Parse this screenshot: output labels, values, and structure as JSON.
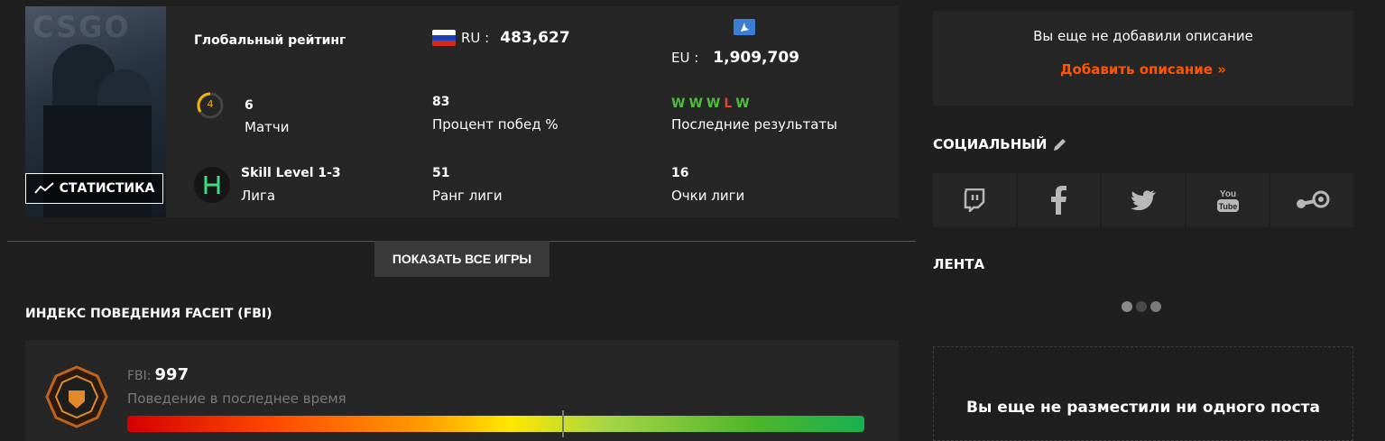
{
  "game_card": {
    "cover_logo": "CSGO",
    "stats_button": "СТАТИСТИКА",
    "global_rating_label": "Глобальный рейтинг",
    "ru_label": "RU :",
    "ru_value": "483,627",
    "eu_label": "EU :",
    "eu_value": "1,909,709",
    "level_badge": "4",
    "matches_value": "6",
    "matches_label": "Матчи",
    "win_rate_value": "83",
    "win_rate_label": "Процент побед %",
    "recent_results": [
      "W",
      "W",
      "W",
      "L",
      "W"
    ],
    "recent_results_label": "Последние результаты",
    "league_value": "Skill Level 1-3",
    "league_label": "Лига",
    "league_rank_value": "51",
    "league_rank_label": "Ранг лиги",
    "league_points_value": "16",
    "league_points_label": "Очки лиги"
  },
  "show_all_games": "ПОКАЗАТЬ ВСЕ ИГРЫ",
  "fbi": {
    "title": "ИНДЕКС ПОВЕДЕНИЯ FACEIT (FBI)",
    "label": "FBI:",
    "value": "997",
    "subtitle": "Поведение в последнее время",
    "bar_level_percent": 59
  },
  "description": {
    "text": "Вы еще не добавили описание",
    "add_link": "Добавить описание »"
  },
  "social": {
    "title": "СОЦИАЛЬНЫЙ",
    "networks": [
      "twitch-icon",
      "facebook-icon",
      "twitter-icon",
      "youtube-icon",
      "steam-icon"
    ]
  },
  "feed": {
    "title": "ЛЕНТА",
    "empty_text": "Вы еще не разместили ни одного поста"
  },
  "colors": {
    "accent": "#ff5500",
    "win": "#4fbe3c",
    "loss": "#e0452a",
    "level": "#f5b400",
    "league": "#3ddc84"
  }
}
